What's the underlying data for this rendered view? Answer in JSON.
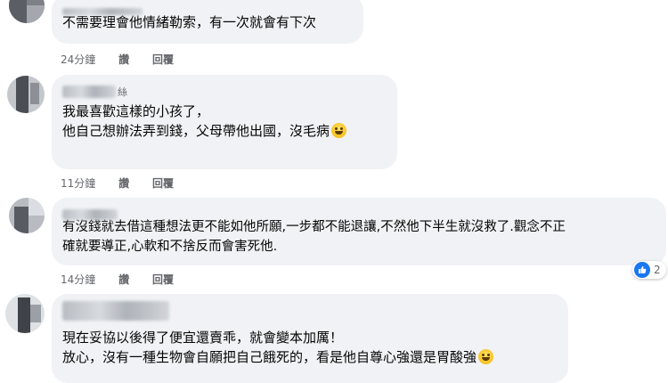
{
  "comments": [
    {
      "author_suffix": "",
      "lines": [
        "不需要理會他情緒勒索，有一次就會有下次"
      ],
      "time": "24分鐘",
      "like_label": "讚",
      "reply_label": "回覆"
    },
    {
      "author_suffix": "絲",
      "lines": [
        "我最喜歡這樣的小孩了，",
        "他自己想辦法弄到錢，父母帶他出國，沒毛病"
      ],
      "emoji": "grinning-face-icon",
      "time": "11分鐘",
      "like_label": "讚",
      "reply_label": "回覆"
    },
    {
      "author_suffix": "",
      "lines": [
        "有沒錢就去借這種想法更不能如他所願,一步都不能退讓,不然他下半生就沒救了.觀念不正",
        "確就要導正,心軟和不捨反而會害死他."
      ],
      "time": "14分鐘",
      "like_label": "讚",
      "reply_label": "回覆",
      "reaction_icon": "thumbs-up-icon",
      "reaction_count": "2"
    },
    {
      "author_suffix": "",
      "lines": [
        "現在妥協以後得了便宜還賣乖，就會變本加厲！",
        "放心，沒有一種生物會自願把自己餓死的，看是他自尊心強還是胃酸強"
      ],
      "emoji": "grinning-sweat-icon"
    }
  ],
  "colors": {
    "bubble": "#f0f2f5",
    "meta_text": "#65676b",
    "like_blue": "#1877f2"
  }
}
